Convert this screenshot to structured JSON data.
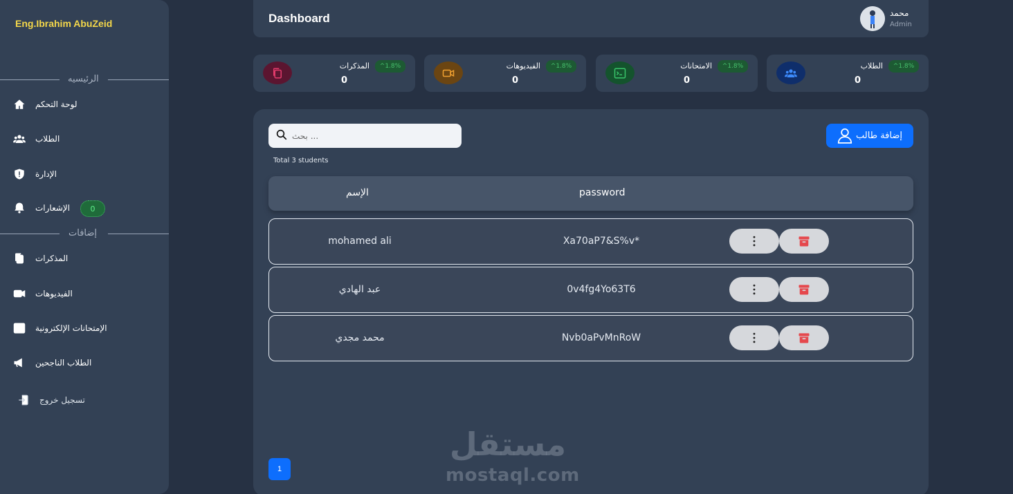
{
  "sidebar": {
    "brand": "Eng.Ibrahim AbuZeid",
    "section_main": "الرئيسيه",
    "section_extra": "إضافات",
    "items": [
      {
        "label": "لوحة التحكم",
        "icon": "home-icon"
      },
      {
        "label": "الطلاب",
        "icon": "users-icon"
      },
      {
        "label": "الإدارة",
        "icon": "shield-icon"
      },
      {
        "label": "الإشعارات",
        "icon": "bell-icon",
        "badge": "0"
      },
      {
        "label": "المذكرات",
        "icon": "notes-icon"
      },
      {
        "label": "الفيديوهات",
        "icon": "video-icon"
      },
      {
        "label": "الإمتحانات الإلكترونية",
        "icon": "terminal-icon"
      },
      {
        "label": "الطلاب الناجحين",
        "icon": "megaphone-icon"
      },
      {
        "label": "تسجيل خروج",
        "icon": "logout-icon"
      }
    ]
  },
  "header": {
    "title": "Dashboard",
    "user_name": "محمد",
    "user_role": "Admin"
  },
  "stats": [
    {
      "label": "المذكرات",
      "value": "0",
      "pct": "1.8%",
      "color": "#c2185b",
      "bg": "#5b1530"
    },
    {
      "label": "الفيديوهات",
      "value": "0",
      "pct": "1.8%",
      "color": "#f0a030",
      "bg": "#6b4512"
    },
    {
      "label": "الامتحانات",
      "value": "0",
      "pct": "1.8%",
      "color": "#39c46a",
      "bg": "#14532d"
    },
    {
      "label": "الطلاب",
      "value": "0",
      "pct": "1.8%",
      "color": "#3d8bfd",
      "bg": "#0f2e6b"
    }
  ],
  "main": {
    "search_placeholder": "بحث ...",
    "total": "Total 3 students",
    "add_button": "إضافة طالب",
    "columns": {
      "name": "الإسم",
      "password": "password"
    },
    "rows": [
      {
        "name": "mohamed ali",
        "password": "Xa70aP7&S%v*"
      },
      {
        "name": "عبد الهادي",
        "password": "0v4fg4Yo63T6"
      },
      {
        "name": "محمد مجدي",
        "password": "Nvb0aPvMnRoW"
      }
    ],
    "page": "1"
  },
  "watermark": {
    "ar": "مستقل",
    "en": "mostaql.com"
  },
  "colors": {
    "accent": "#0d6efd",
    "brand": "#f5d84a",
    "delete": "#e5484d"
  }
}
